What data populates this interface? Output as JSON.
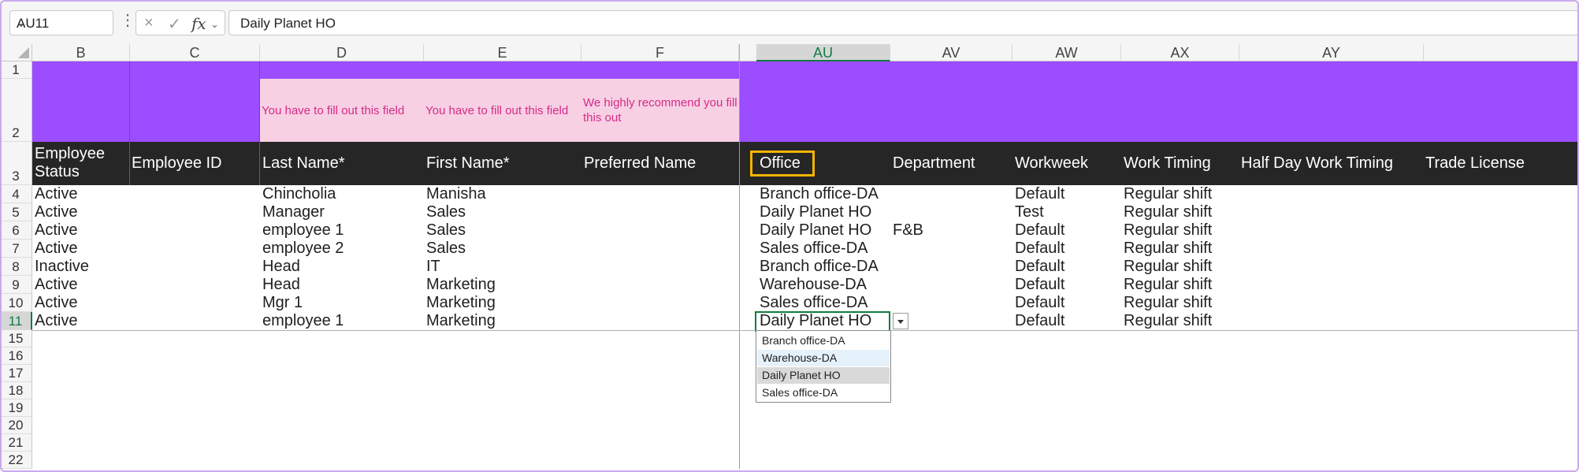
{
  "formula_bar": {
    "name_box": "AU11",
    "fx_label": "fx",
    "cancel_icon": "×",
    "confirm_icon": "✓",
    "formula_value": "Daily Planet HO"
  },
  "columns": [
    "B",
    "C",
    "D",
    "E",
    "F",
    "AU",
    "AV",
    "AW",
    "AX",
    "AY"
  ],
  "selected_column": "AU",
  "row_numbers": [
    "1",
    "2",
    "3",
    "4",
    "5",
    "6",
    "7",
    "8",
    "9",
    "10",
    "11",
    "15",
    "16",
    "17",
    "18",
    "19",
    "20",
    "21",
    "22"
  ],
  "hints": {
    "d": "You have to fill out this field",
    "e": "You have to fill out this field",
    "f": "We highly recommend you fill this out"
  },
  "headers": {
    "b": "Employee Status",
    "c": "Employee ID",
    "d": "Last Name*",
    "e": "First Name*",
    "f": "Preferred Name",
    "au": "Office",
    "av": "Department",
    "aw": "Workweek",
    "ax": "Work Timing",
    "ay": "Half Day Work Timing",
    "az": "Trade License"
  },
  "rows": [
    {
      "b": "Active",
      "d": "Chincholia",
      "e": "Manisha",
      "au": "Branch office-DA",
      "av": "",
      "aw": "Default",
      "ax": "Regular shift"
    },
    {
      "b": "Active",
      "d": "Manager",
      "e": "Sales",
      "au": "Daily Planet HO",
      "av": "",
      "aw": "Test",
      "ax": "Regular shift"
    },
    {
      "b": "Active",
      "d": "employee 1",
      "e": "Sales",
      "au": "Daily Planet HO",
      "av": "F&B",
      "aw": "Default",
      "ax": "Regular shift"
    },
    {
      "b": "Active",
      "d": "employee 2",
      "e": "Sales",
      "au": "Sales office-DA",
      "av": "",
      "aw": "Default",
      "ax": "Regular shift"
    },
    {
      "b": "Inactive",
      "d": "Head",
      "e": "IT",
      "au": "Branch office-DA",
      "av": "",
      "aw": "Default",
      "ax": "Regular shift"
    },
    {
      "b": "Active",
      "d": "Head",
      "e": "Marketing",
      "au": "Warehouse-DA",
      "av": "",
      "aw": "Default",
      "ax": "Regular shift"
    },
    {
      "b": "Active",
      "d": "Mgr 1",
      "e": "Marketing",
      "au": "Sales office-DA",
      "av": "",
      "aw": "Default",
      "ax": "Regular shift"
    },
    {
      "b": "Active",
      "d": "employee 1",
      "e": "Marketing",
      "au": "Daily Planet HO",
      "av": "",
      "aw": "Default",
      "ax": "Regular shift"
    }
  ],
  "dropdown": {
    "options": [
      "Branch office-DA",
      "Warehouse-DA",
      "Daily Planet HO",
      "Sales office-DA"
    ],
    "hovered": "Warehouse-DA",
    "selected": "Daily Planet HO"
  },
  "colors": {
    "header_band": "#9c4dff",
    "hint_fill": "#f7d0e4",
    "hint_text": "#d62a87",
    "header_row": "#262626",
    "highlight_border": "#f5b400",
    "selection": "#107c41"
  }
}
